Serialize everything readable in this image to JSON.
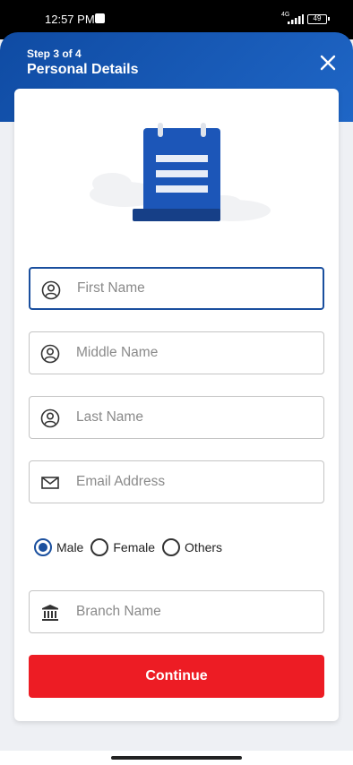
{
  "status_bar": {
    "time": "12:57 PM",
    "network": "4G",
    "battery": "49"
  },
  "header": {
    "step": "Step 3 of 4",
    "title": "Personal Details"
  },
  "form": {
    "first_name_placeholder": "First Name",
    "middle_name_placeholder": "Middle Name",
    "last_name_placeholder": "Last Name",
    "email_placeholder": "Email Address",
    "branch_placeholder": "Branch Name"
  },
  "gender": {
    "options": [
      "Male",
      "Female",
      "Others"
    ],
    "selected": "Male"
  },
  "continue_label": "Continue",
  "colors": {
    "primary_blue": "#1a4f9e",
    "header_blue": "#1f66c6",
    "accent_red": "#ed1c24"
  }
}
